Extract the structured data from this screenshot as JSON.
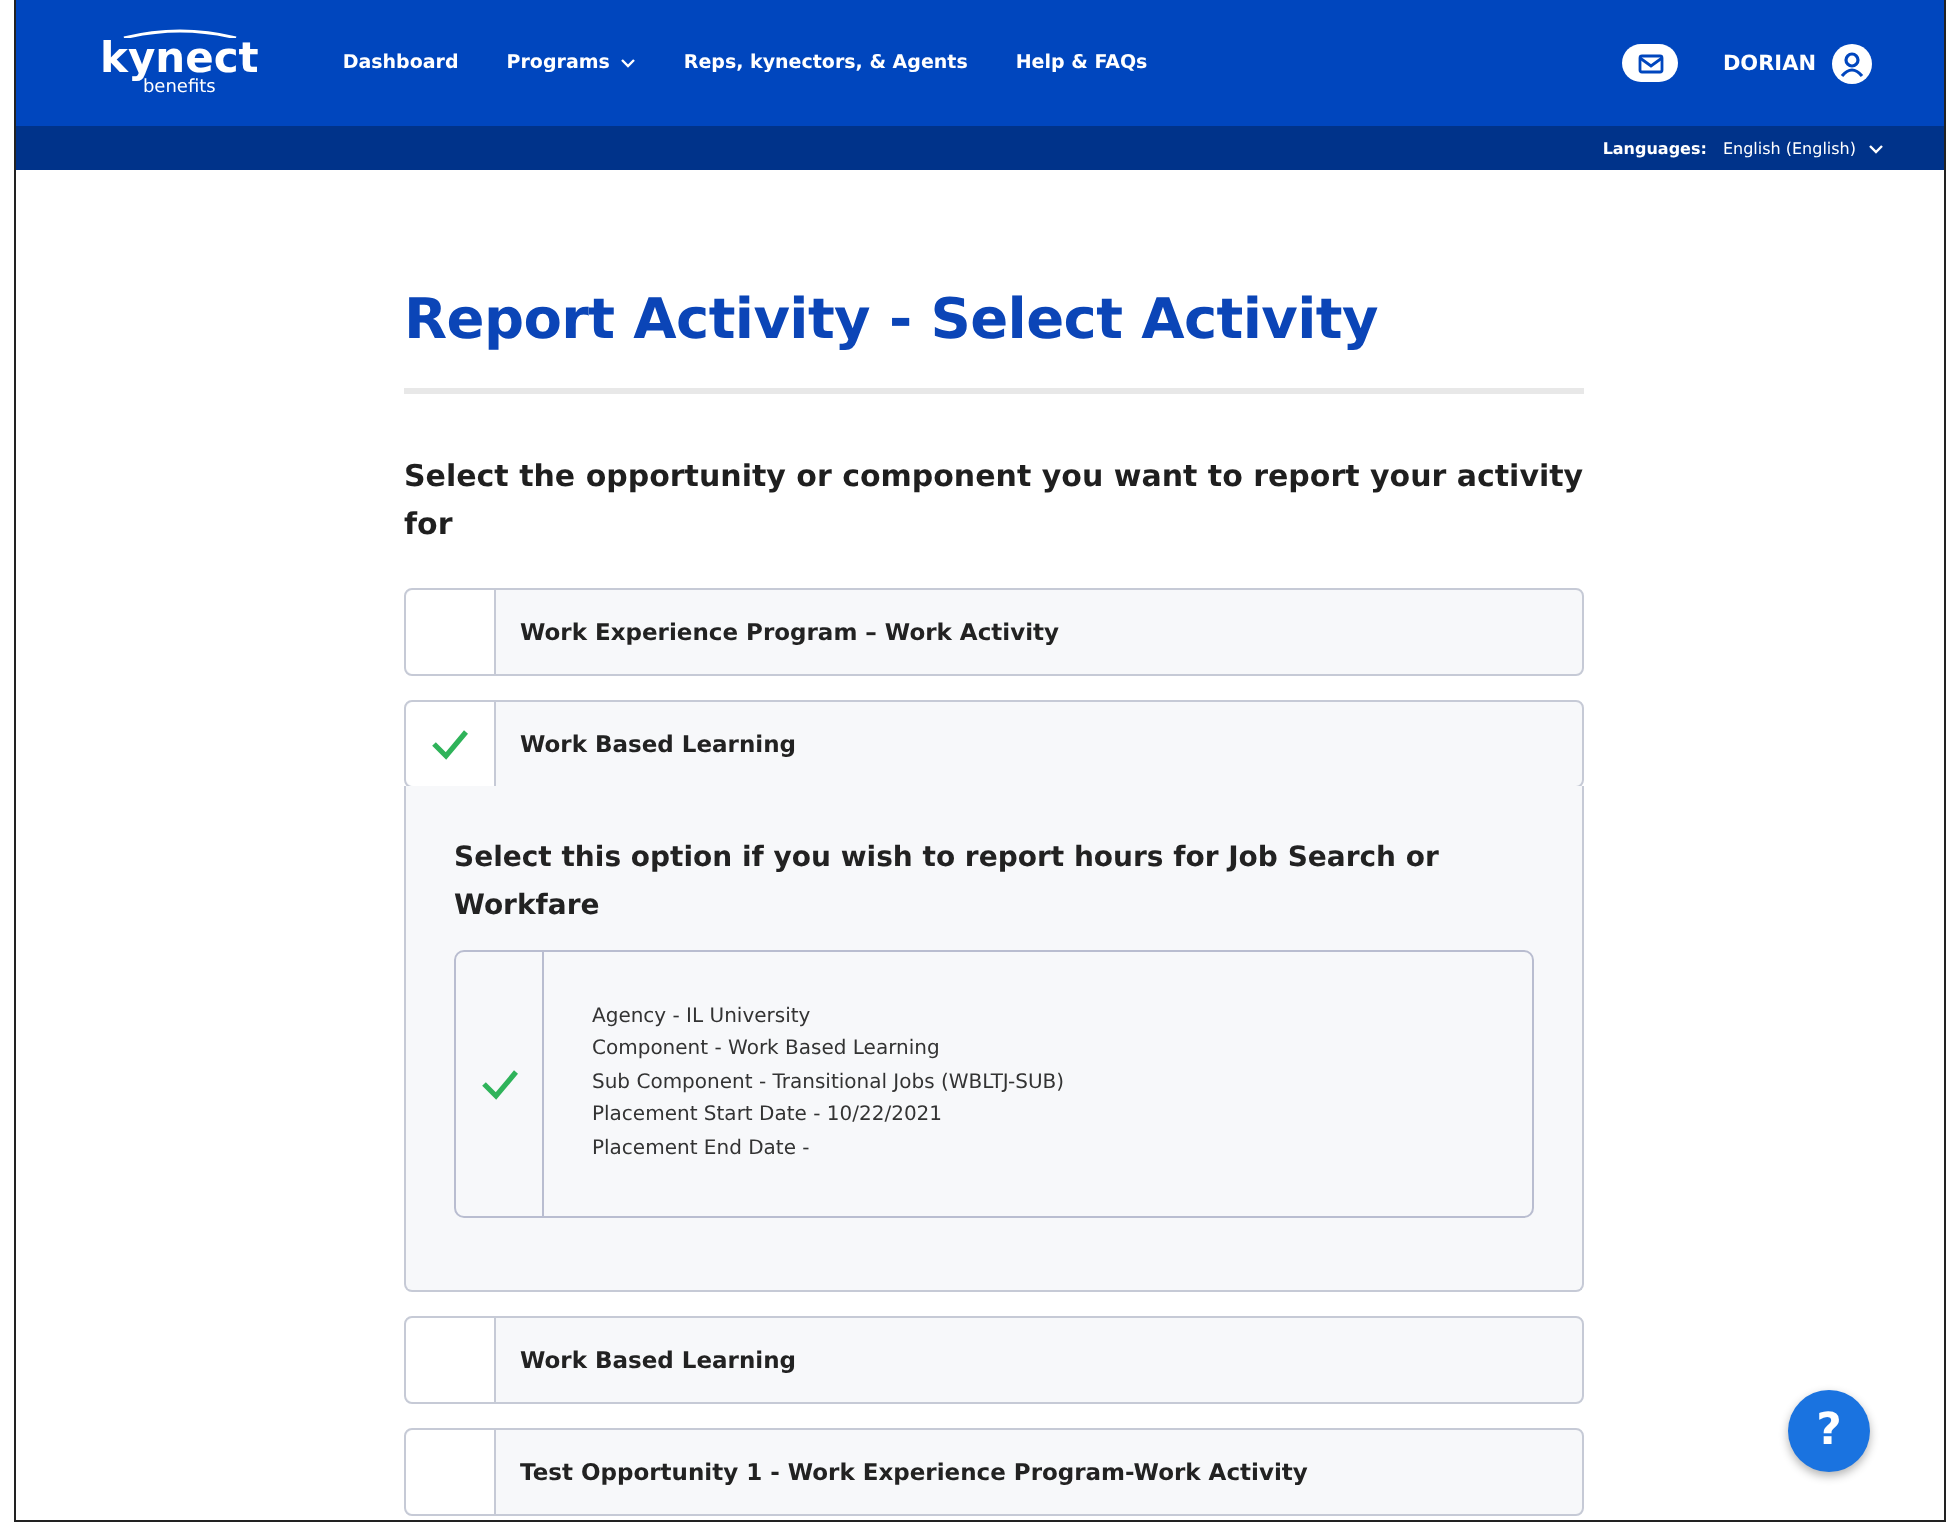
{
  "header": {
    "logo": "kynect",
    "logo_sub": "benefits",
    "nav": [
      {
        "label": "Dashboard",
        "dropdown": false
      },
      {
        "label": "Programs",
        "dropdown": true
      },
      {
        "label": "Reps, kynectors, & Agents",
        "dropdown": false
      },
      {
        "label": "Help & FAQs",
        "dropdown": false
      }
    ],
    "user": "DORIAN"
  },
  "language_bar": {
    "label": "Languages:",
    "value": "English (English)"
  },
  "title": "Report Activity - Select Activity",
  "question": "Select the opportunity or component you want to report your activity for",
  "options": [
    {
      "label": "Work Experience Program – Work Activity",
      "selected": false
    },
    {
      "label": "Work Based Learning",
      "selected": true,
      "detail": {
        "prompt": "Select this option if you wish to report hours for Job Search or Workfare",
        "cards": [
          {
            "selected": true,
            "lines": [
              "Agency - IL University",
              "Component - Work Based Learning",
              "Sub Component - Transitional Jobs (WBLTJ-SUB)",
              "Placement Start Date - 10/22/2021",
              "Placement End Date -"
            ]
          }
        ]
      }
    },
    {
      "label": "Work Based Learning",
      "selected": false
    },
    {
      "label": "Test Opportunity 1 - Work Experience Program-Work Activity",
      "selected": false
    }
  ],
  "help_button": "?"
}
